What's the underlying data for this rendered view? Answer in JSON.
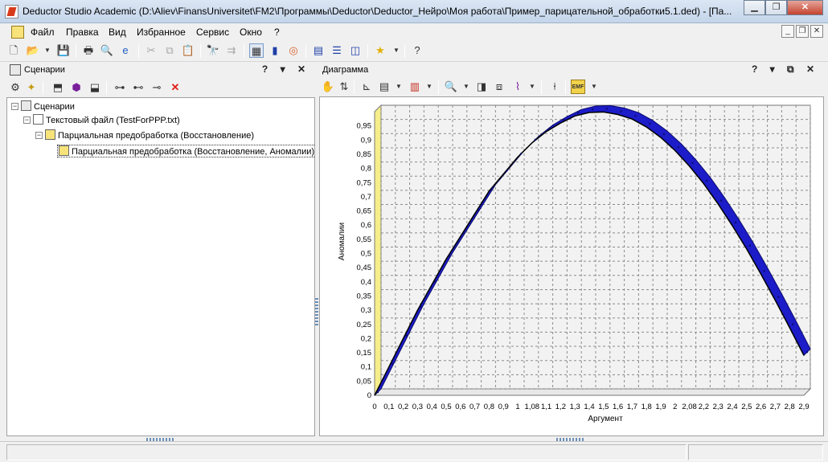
{
  "window": {
    "title": "Deductor Studio Academic (D:\\Aliev\\FinansUniversitet\\FM2\\Программы\\Deductor\\Deductor_Нейро\\Моя работа\\Пример_парицательной_обработки5.1.ded) - [Па...",
    "minimize": "▁",
    "restore": "❐",
    "close": "✕"
  },
  "menu": {
    "items": [
      "Файл",
      "Правка",
      "Вид",
      "Избранное",
      "Сервис",
      "Окно",
      "?"
    ]
  },
  "left_pane": {
    "title": "Сценарии",
    "controls": "? ▾ ✕",
    "tree": [
      {
        "label": "Сценарии"
      },
      {
        "label": "Текстовый файл (TestForPPP.txt)"
      },
      {
        "label": "Парциальная предобработка (Восстановление)"
      },
      {
        "label": "Парциальная предобработка (Восстановление, Аномалии)"
      }
    ]
  },
  "right_pane": {
    "title": "Диаграмма",
    "controls": "? ▾ ⧉ ✕"
  },
  "chart_data": {
    "type": "line",
    "xlabel": "Аргумент",
    "ylabel": "Аномалии",
    "x_tick_labels": [
      "0",
      "0,1",
      "0,2",
      "0,3",
      "0,4",
      "0,5",
      "0,6",
      "0,7",
      "0,8",
      "0,9",
      "1",
      "1,08",
      "1,1",
      "1,2",
      "1,3",
      "1,4",
      "1,5",
      "1,6",
      "1,7",
      "1,8",
      "1,9",
      "2",
      "2,08",
      "2,2",
      "2,3",
      "2,4",
      "2,5",
      "2,6",
      "2,7",
      "2,8",
      "2,9"
    ],
    "y_tick_labels": [
      "0",
      "0,05",
      "0,1",
      "0,15",
      "0,2",
      "0,25",
      "0,3",
      "0,35",
      "0,4",
      "0,45",
      "0,5",
      "0,55",
      "0,6",
      "0,65",
      "0,7",
      "0,75",
      "0,8",
      "0,85",
      "0,9",
      "0,95"
    ],
    "ylim": [
      0,
      1
    ],
    "xlim": [
      0,
      3
    ],
    "grid": true,
    "series": [
      {
        "color": "#1c1cc8",
        "x": [
          0,
          0.1,
          0.2,
          0.3,
          0.4,
          0.5,
          0.6,
          0.7,
          0.8,
          0.9,
          1.0,
          1.1,
          1.2,
          1.3,
          1.4,
          1.5,
          1.6,
          1.7,
          1.8,
          1.9,
          2.0,
          2.1,
          2.2,
          2.3,
          2.4,
          2.5,
          2.6,
          2.7,
          2.8,
          2.9,
          3.0
        ],
        "y": [
          0,
          0.1,
          0.2,
          0.3,
          0.39,
          0.48,
          0.56,
          0.64,
          0.72,
          0.78,
          0.84,
          0.89,
          0.93,
          0.96,
          0.985,
          0.997,
          0.999,
          0.99,
          0.974,
          0.946,
          0.909,
          0.863,
          0.808,
          0.746,
          0.675,
          0.598,
          0.516,
          0.427,
          0.335,
          0.239,
          0.141
        ]
      }
    ]
  }
}
